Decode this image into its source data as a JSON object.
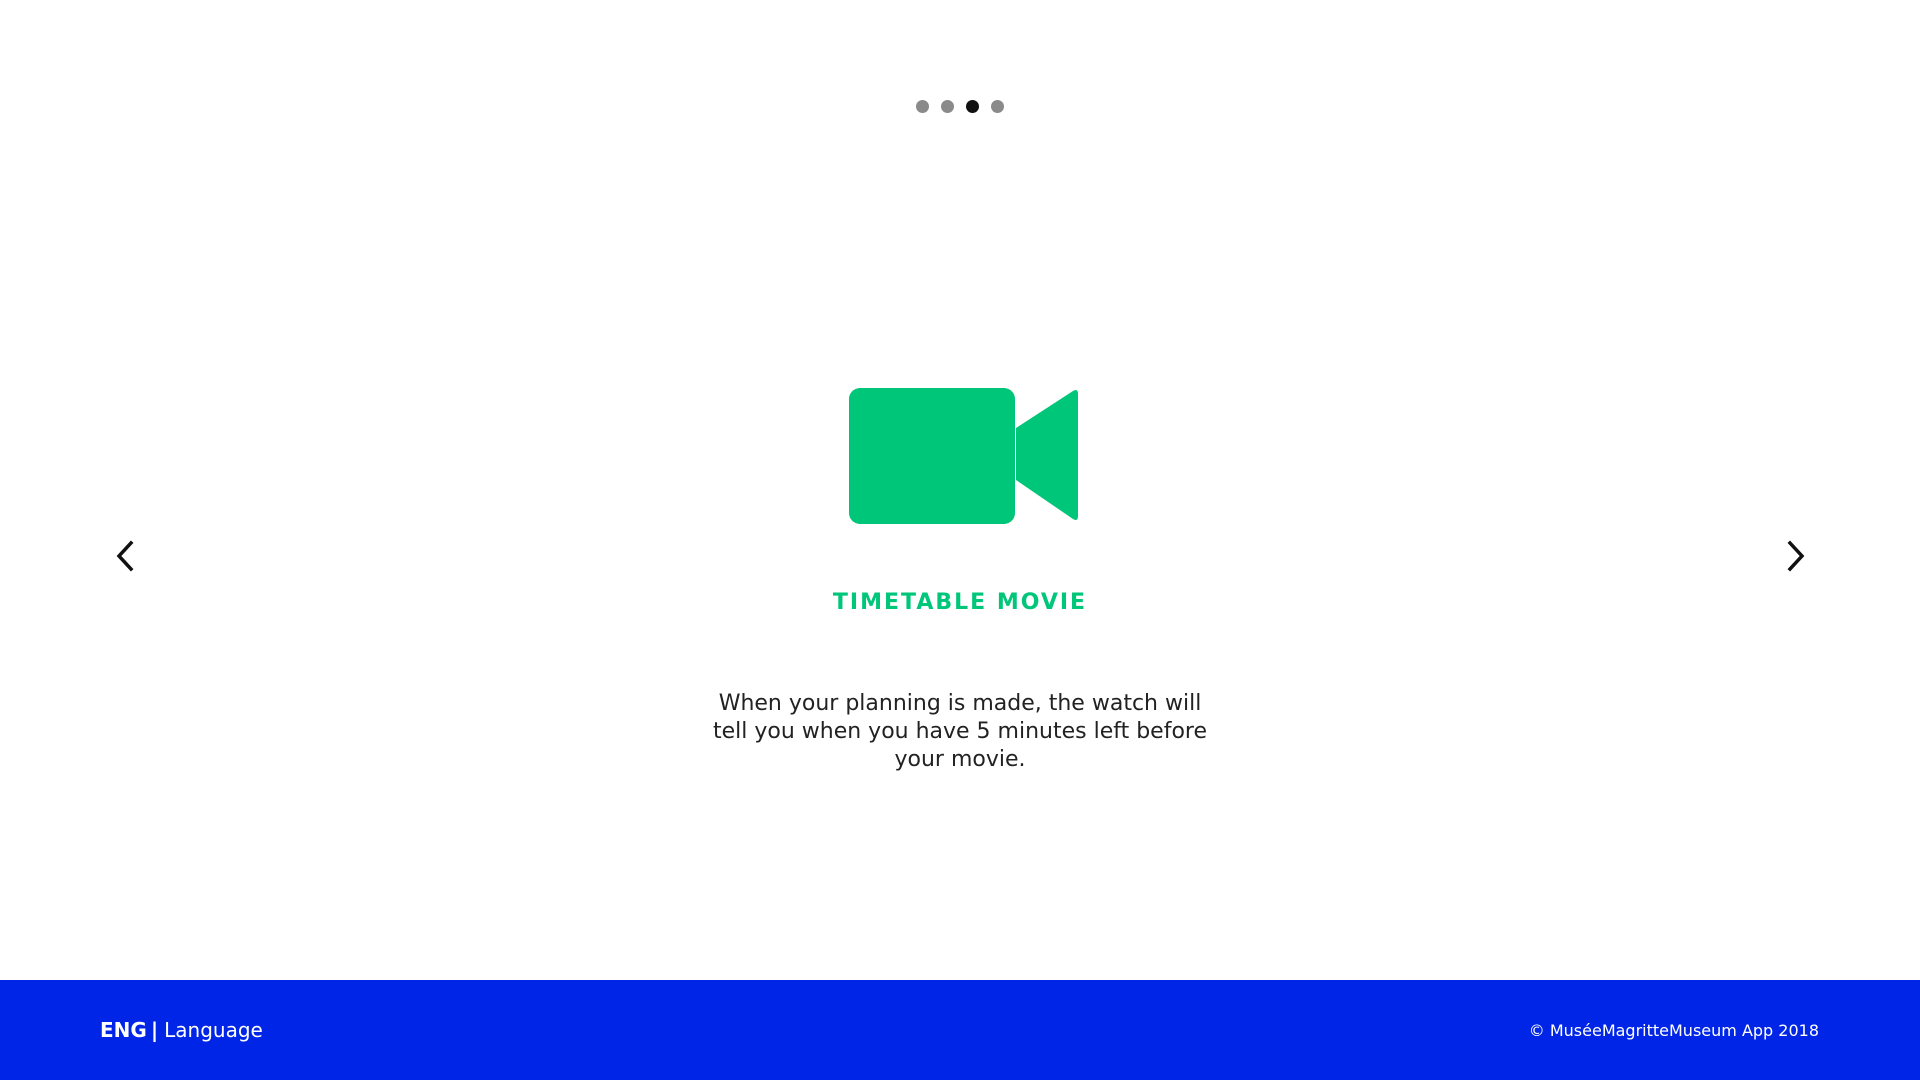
{
  "pagination": {
    "count": 4,
    "active_index": 2
  },
  "navigation": {
    "prev_icon": "chevron-left-icon",
    "next_icon": "chevron-right-icon"
  },
  "slide": {
    "icon": "video-camera-icon",
    "title": "TIMETABLE MOVIE",
    "description": "When your planning is made, the watch will tell you when you have 5 minutes left before your movie."
  },
  "footer": {
    "language_code": "ENG",
    "language_separator": "|",
    "language_label": "Language",
    "copyright": "© MuséeMagritteMuseum App 2018"
  },
  "colors": {
    "accent": "#00c67a",
    "footer_background": "#0025e6",
    "dot_inactive": "#8a8a8a",
    "dot_active": "#111111",
    "text": "#222222"
  }
}
